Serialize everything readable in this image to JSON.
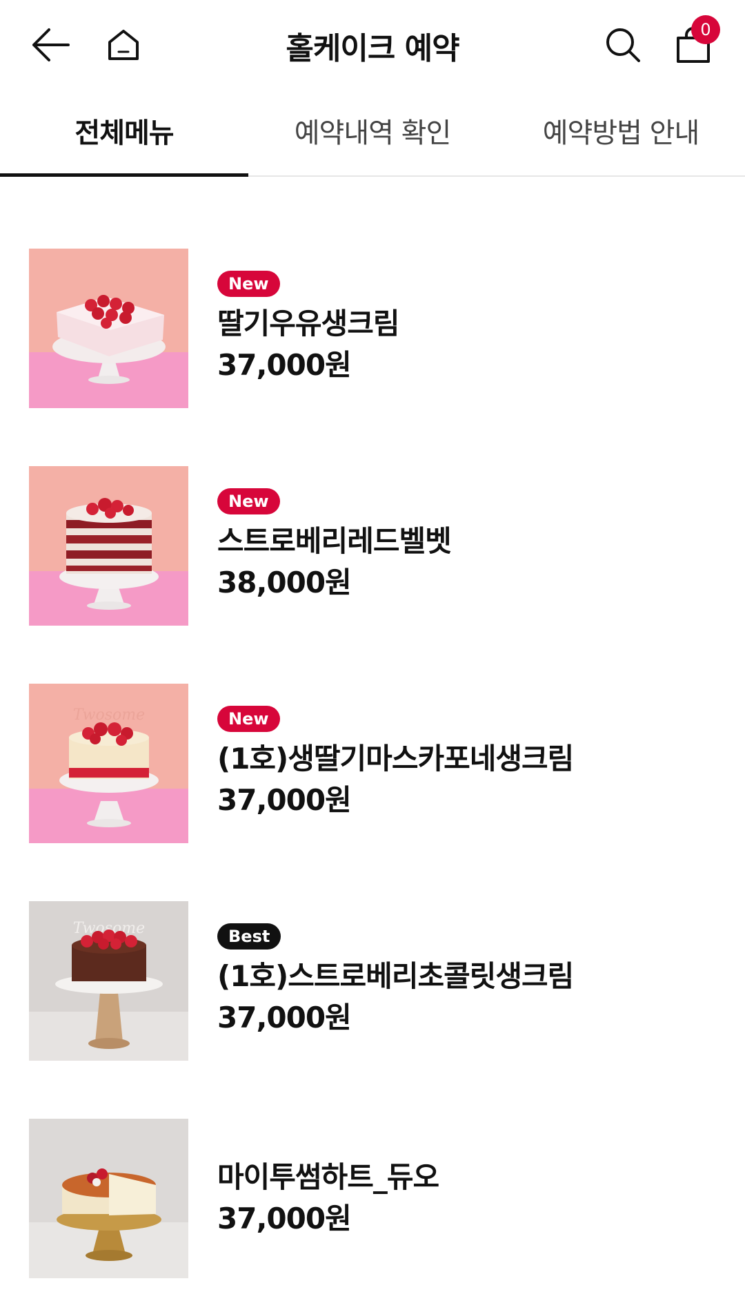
{
  "header": {
    "title": "홀케이크 예약",
    "cart_count": "0",
    "icons": [
      "back-arrow-icon",
      "home-icon",
      "search-icon",
      "shopping-bag-icon"
    ]
  },
  "tabs": [
    {
      "label": "전체메뉴",
      "active": true
    },
    {
      "label": "예약내역 확인",
      "active": false
    },
    {
      "label": "예약방법 안내",
      "active": false
    }
  ],
  "products": [
    {
      "badge": "New",
      "name": "딸기우유생크림",
      "price": "37,000원"
    },
    {
      "badge": "New",
      "name": "스트로베리레드벨벳",
      "price": "38,000원"
    },
    {
      "badge": "New",
      "name": "(1호)생딸기마스카포네생크림",
      "price": "37,000원",
      "image_text": "Twosome"
    },
    {
      "badge": "Best",
      "name": "(1호)스트로베리초콜릿생크림",
      "price": "37,000원",
      "image_text": "Twosome"
    },
    {
      "badge": "",
      "name": "마이투썸하트_듀오",
      "price": "37,000원"
    }
  ],
  "colors": {
    "accent": "#d7063a",
    "best_badge": "#111111",
    "text": "#111111",
    "tab_inactive": "#444444"
  }
}
